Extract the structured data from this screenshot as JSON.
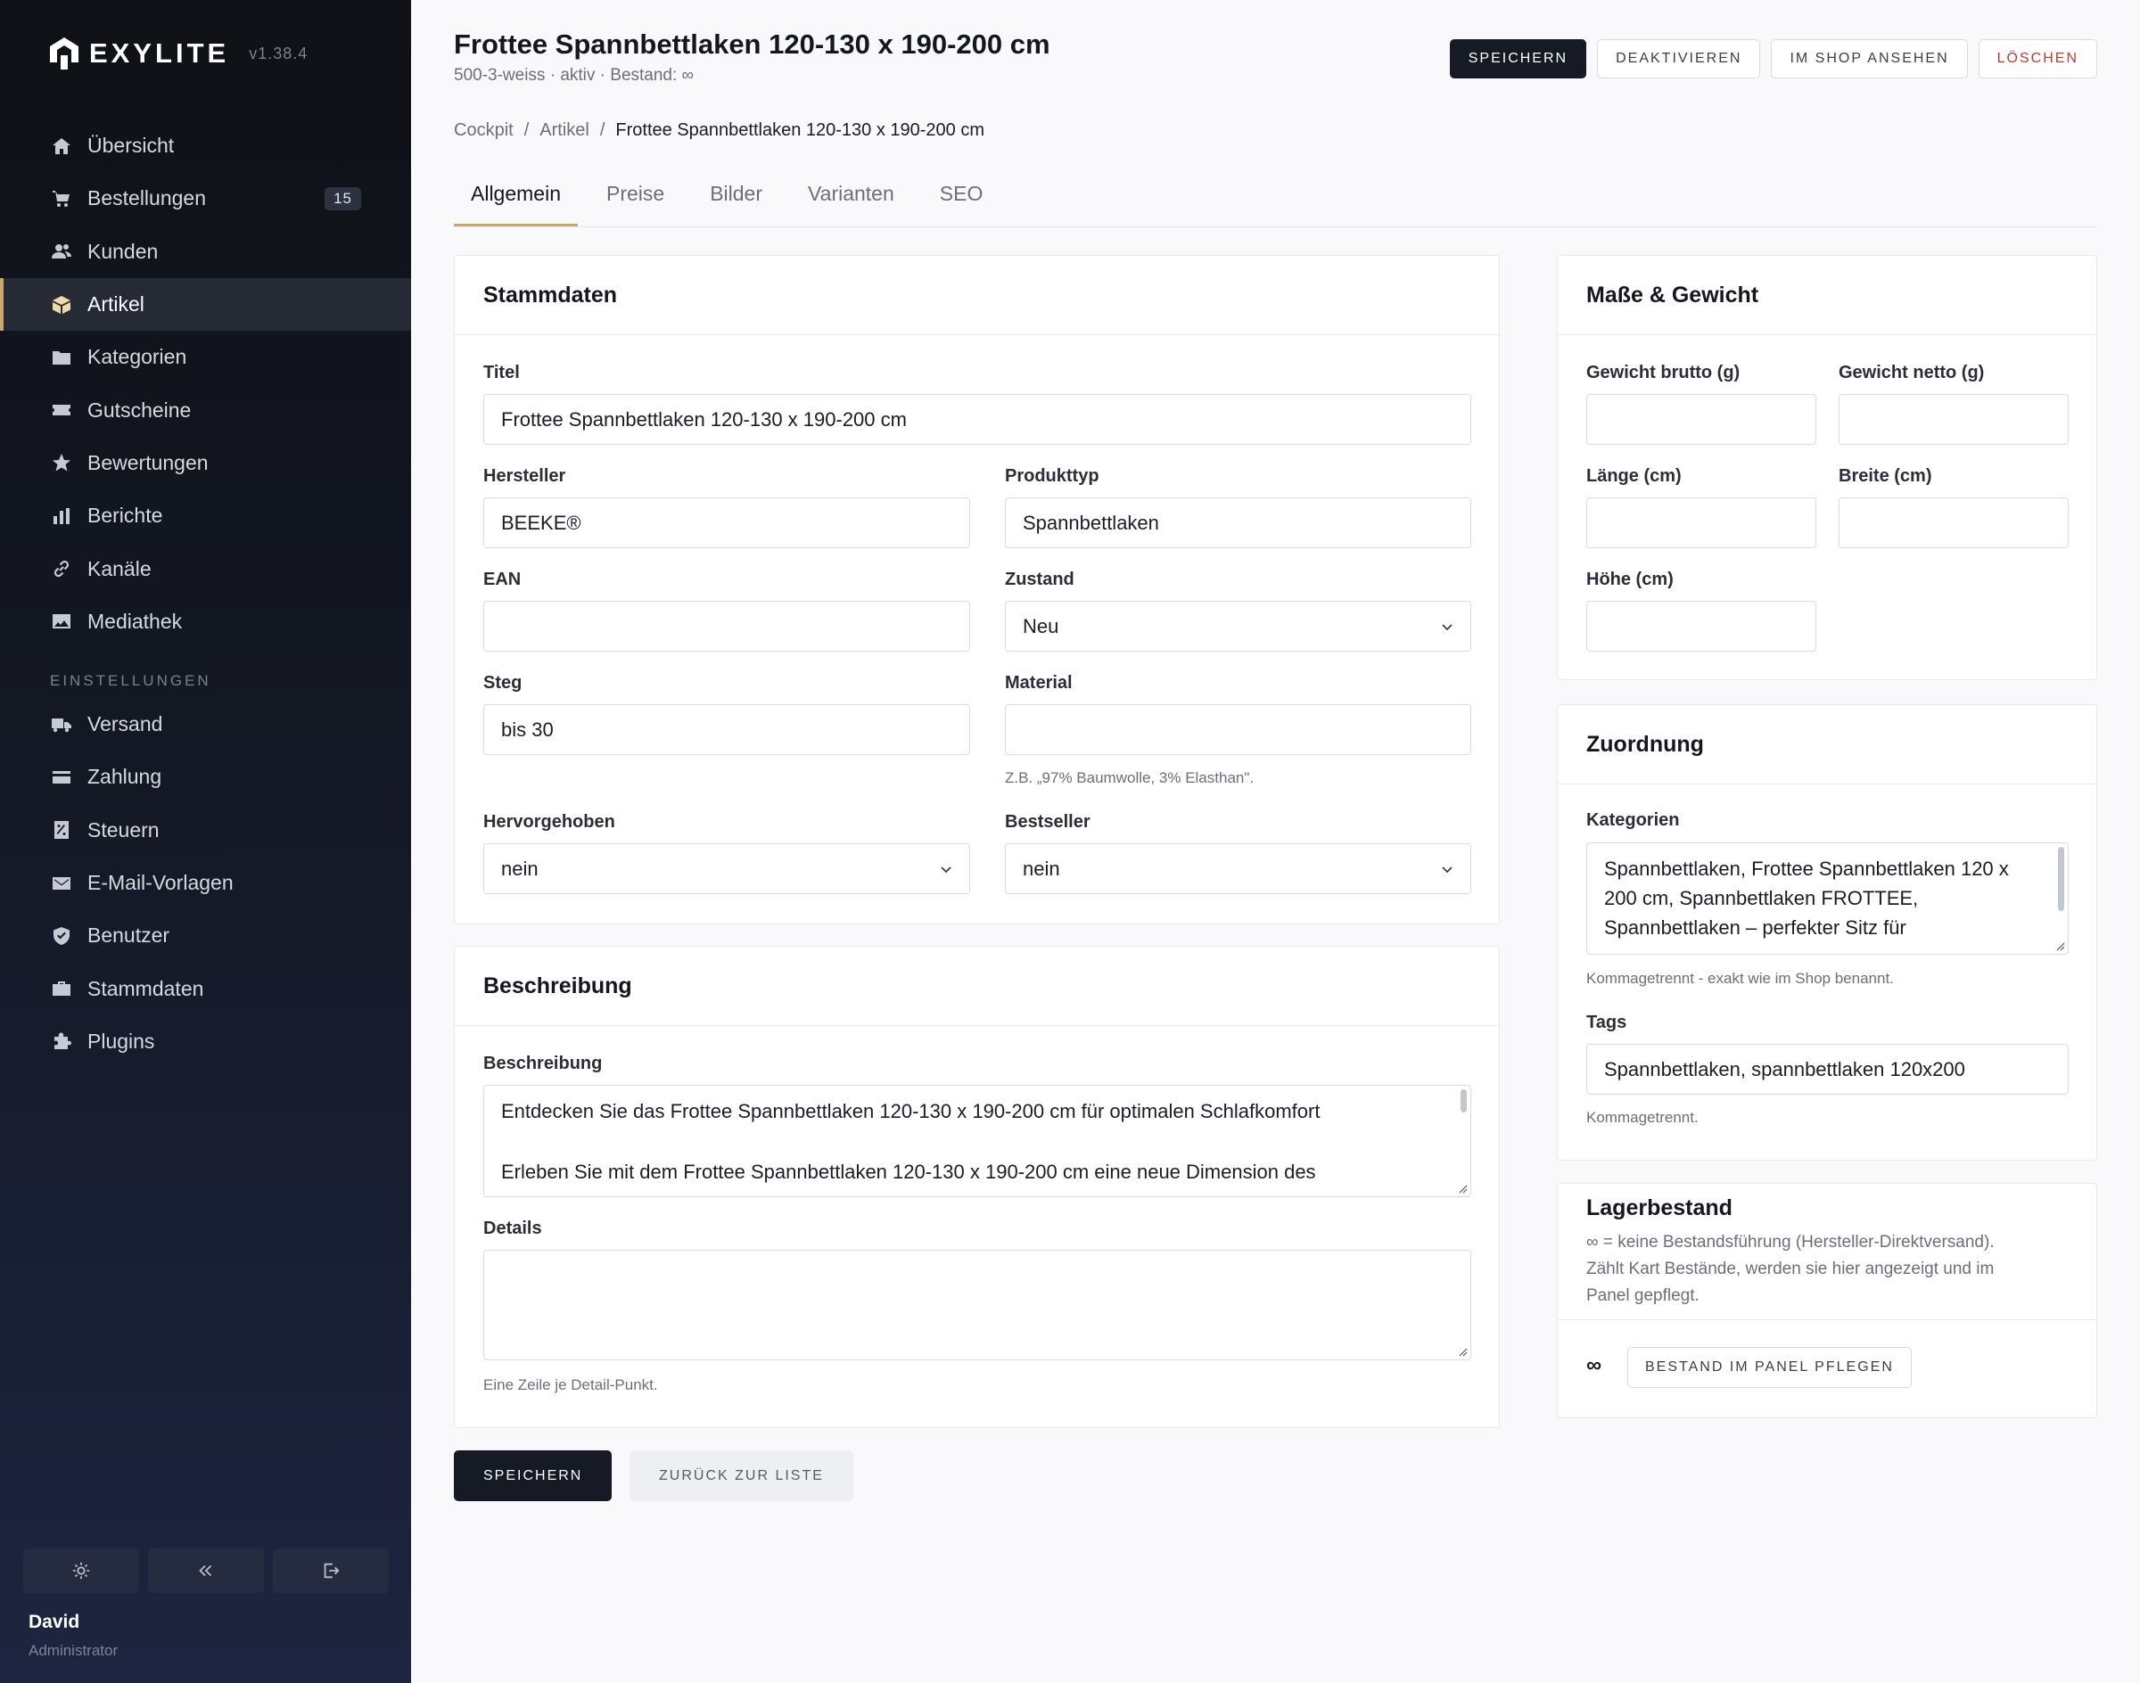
{
  "app": {
    "name": "EXYLITE",
    "version": "v1.38.4"
  },
  "nav": {
    "items": [
      {
        "label": "Übersicht",
        "icon": "home-icon"
      },
      {
        "label": "Bestellungen",
        "icon": "cart-icon",
        "badge": "15"
      },
      {
        "label": "Kunden",
        "icon": "users-icon"
      },
      {
        "label": "Artikel",
        "icon": "box-icon",
        "active": true
      },
      {
        "label": "Kategorien",
        "icon": "folder-icon"
      },
      {
        "label": "Gutscheine",
        "icon": "ticket-icon"
      },
      {
        "label": "Bewertungen",
        "icon": "star-icon"
      },
      {
        "label": "Berichte",
        "icon": "bar-chart-icon"
      },
      {
        "label": "Kanäle",
        "icon": "link-icon"
      },
      {
        "label": "Mediathek",
        "icon": "image-icon"
      }
    ],
    "section_label": "EINSTELLUNGEN",
    "settings": [
      {
        "label": "Versand",
        "icon": "truck-icon"
      },
      {
        "label": "Zahlung",
        "icon": "credit-card-icon"
      },
      {
        "label": "Steuern",
        "icon": "receipt-icon"
      },
      {
        "label": "E-Mail-Vorlagen",
        "icon": "mail-icon"
      },
      {
        "label": "Benutzer",
        "icon": "shield-icon"
      },
      {
        "label": "Stammdaten",
        "icon": "briefcase-icon"
      },
      {
        "label": "Plugins",
        "icon": "puzzle-icon"
      }
    ]
  },
  "user": {
    "name": "David",
    "role": "Administrator"
  },
  "header": {
    "title": "Frottee Spannbettlaken 120-130 x 190-200 cm",
    "subtitle": "500-3-weiss · aktiv · Bestand: ∞",
    "actions": {
      "save": "SPEICHERN",
      "deactivate": "DEAKTIVIEREN",
      "view_shop": "IM SHOP ANSEHEN",
      "delete": "LÖSCHEN"
    }
  },
  "breadcrumb": [
    "Cockpit",
    "Artikel",
    "Frottee Spannbettlaken 120-130 x 190-200 cm"
  ],
  "tabs": [
    "Allgemein",
    "Preise",
    "Bilder",
    "Varianten",
    "SEO"
  ],
  "stammdaten": {
    "heading": "Stammdaten",
    "titel": {
      "label": "Titel",
      "value": "Frottee Spannbettlaken 120-130 x 190-200 cm"
    },
    "hersteller": {
      "label": "Hersteller",
      "value": "BEEKE®"
    },
    "produkttyp": {
      "label": "Produkttyp",
      "value": "Spannbettlaken"
    },
    "ean": {
      "label": "EAN",
      "value": ""
    },
    "zustand": {
      "label": "Zustand",
      "value": "Neu"
    },
    "steg": {
      "label": "Steg",
      "value": "bis 30"
    },
    "material": {
      "label": "Material",
      "value": "",
      "hint": "Z.B. „97% Baumwolle, 3% Elasthan\"."
    },
    "hervorgehoben": {
      "label": "Hervorgehoben",
      "value": "nein"
    },
    "bestseller": {
      "label": "Bestseller",
      "value": "nein"
    }
  },
  "beschreibung": {
    "heading": "Beschreibung",
    "label": "Beschreibung",
    "line1": "Entdecken Sie das Frottee Spannbettlaken 120-130 x 190-200 cm für optimalen Schlafkomfort",
    "line2": "Erleben Sie mit dem Frottee Spannbettlaken 120-130 x 190-200 cm eine neue Dimension des",
    "details_label": "Details",
    "details_value": "",
    "details_hint": "Eine Zeile je Detail-Punkt."
  },
  "footer": {
    "save": "SPEICHERN",
    "back": "ZURÜCK ZUR LISTE"
  },
  "masse": {
    "heading": "Maße & Gewicht",
    "brutto": "Gewicht brutto (g)",
    "netto": "Gewicht netto (g)",
    "laenge": "Länge (cm)",
    "breite": "Breite (cm)",
    "hoehe": "Höhe (cm)"
  },
  "zuordnung": {
    "heading": "Zuordnung",
    "kategorien_label": "Kategorien",
    "kategorien_lines": [
      "Spannbettlaken, Frottee Spannbettlaken 120 x",
      "200 cm, Spannbettlaken FROTTEE,",
      "Spannbettlaken – perfekter Sitz für"
    ],
    "kategorien_hint": "Kommagetrennt - exakt wie im Shop benannt.",
    "tags_label": "Tags",
    "tags_value": "Spannbettlaken, spannbettlaken 120x200",
    "tags_hint": "Kommagetrennt."
  },
  "lager": {
    "heading": "Lagerbestand",
    "desc_lines": [
      "∞ = keine Bestandsführung (Hersteller-Direktversand).",
      "Zählt Kart Bestände, werden sie hier angezeigt und im",
      "Panel gepflegt."
    ],
    "value": "∞",
    "button": "BESTAND IM PANEL PFLEGEN"
  },
  "colors": {
    "accent": "#c9a66b",
    "sidebar": "#141824",
    "primary_button": "#161a24",
    "danger": "#c0392b"
  }
}
